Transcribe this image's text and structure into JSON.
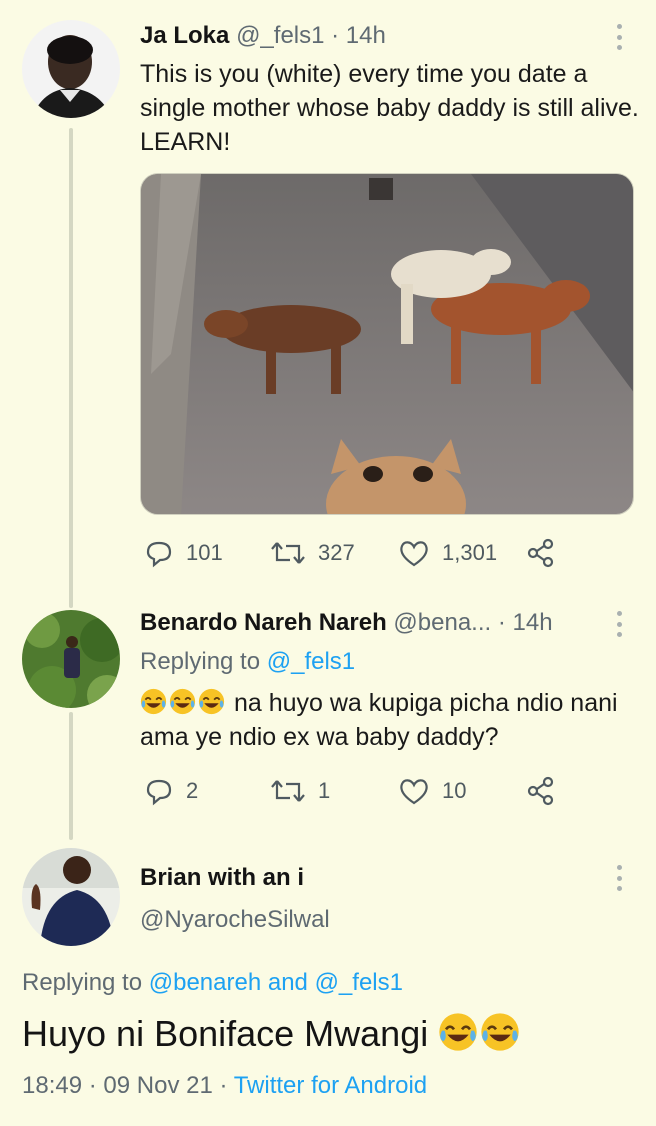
{
  "tweet1": {
    "name": "Ja Loka",
    "handle": "@_fels1",
    "time": "· 14h",
    "text": "This is you (white) every time you date a single mother whose baby daddy is still alive. LEARN!",
    "replies": "101",
    "retweets": "327",
    "likes": "1,301"
  },
  "tweet2": {
    "name": "Benardo Nareh Nareh",
    "handle": "@bena...",
    "time": "· 14h",
    "replying_prefix": "Replying to",
    "replying_to": "@_fels1",
    "text": "na huyo wa kupiga picha ndio nani ama ye ndio ex wa baby daddy?",
    "replies": "2",
    "retweets": "1",
    "likes": "10"
  },
  "tweet3": {
    "name": "Brian with an i",
    "handle": "@NyarocheSilwal",
    "replying_prefix": "Replying to",
    "replying_to": "@benareh and @_fels1",
    "text": "Huyo ni Boniface Mwangi",
    "time": "18:49",
    "date": "09 Nov 21",
    "source": "Twitter for Android",
    "sep": "·"
  },
  "colors": {
    "background": "#fbfbe4",
    "link": "#1da1f2",
    "muted": "#5f6a72"
  },
  "icons": [
    "more-icon",
    "reply-icon",
    "retweet-icon",
    "like-icon",
    "share-icon",
    "tears-of-joy-emoji"
  ]
}
